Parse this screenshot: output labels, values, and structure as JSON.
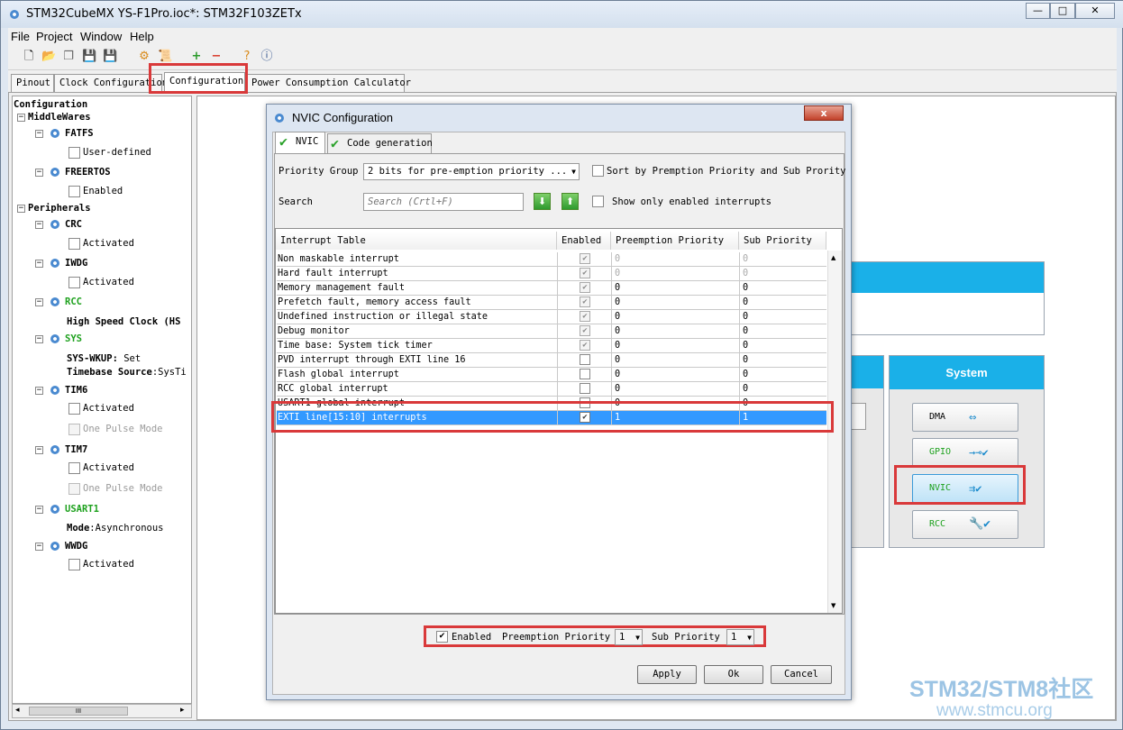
{
  "app": {
    "title": "STM32CubeMX YS-F1Pro.ioc*: STM32F103ZETx"
  },
  "window_controls": {
    "minimize": "—",
    "maximize": "□",
    "close": "✕"
  },
  "menu": [
    "File",
    "Project",
    "Window",
    "Help"
  ],
  "tabs": [
    "Pinout",
    "Clock Configuration",
    "Configuration",
    "Power Consumption Calculator"
  ],
  "tree": {
    "root": "Configuration",
    "middlewares": "MiddleWares",
    "fatfs": "FATFS",
    "user_defined": "User-defined",
    "freertos": "FREERTOS",
    "enabled": "Enabled",
    "peripherals": "Peripherals",
    "crc": "CRC",
    "activated": "Activated",
    "iwdg": "IWDG",
    "rcc": "RCC",
    "hse": "High Speed Clock (HS",
    "sys": "SYS",
    "sys_wkup_k": "SYS-WKUP:",
    "sys_wkup_v": " Set",
    "timebase_k": "Timebase Source",
    "timebase_v": ":SysTi",
    "tim6": "TIM6",
    "one_pulse": "One Pulse Mode",
    "tim7": "TIM7",
    "usart1": "USART1",
    "mode_k": "Mode",
    "mode_v": ":Asynchronous",
    "wwdg": "WWDG",
    "scroll_thumb": "III"
  },
  "system_panel": {
    "title": "System",
    "buttons": [
      "DMA",
      "GPIO",
      "NVIC",
      "RCC"
    ]
  },
  "dialog": {
    "title": "NVIC Configuration",
    "close": "x",
    "tabs": [
      "NVIC",
      "Code generation"
    ],
    "priority_group_label": "Priority Group",
    "priority_group_value": "2 bits for pre-emption priority ...",
    "sort_label": "Sort by Premption Priority and Sub Prority",
    "search_label": "Search",
    "search_placeholder": "Search (Crtl+F)",
    "show_enabled_label": "Show only enabled interrupts",
    "columns": [
      "Interrupt Table",
      "Enabled",
      "Preemption Priority",
      "Sub Priority"
    ],
    "rows": [
      {
        "name": "Non maskable interrupt",
        "enabled": true,
        "locked": true,
        "pre": "0",
        "sub": "0",
        "gray": true
      },
      {
        "name": "Hard fault interrupt",
        "enabled": true,
        "locked": true,
        "pre": "0",
        "sub": "0",
        "gray": true
      },
      {
        "name": "Memory management fault",
        "enabled": true,
        "locked": true,
        "pre": "0",
        "sub": "0",
        "gray": false
      },
      {
        "name": "Prefetch fault, memory access fault",
        "enabled": true,
        "locked": true,
        "pre": "0",
        "sub": "0",
        "gray": false
      },
      {
        "name": "Undefined instruction or illegal state",
        "enabled": true,
        "locked": true,
        "pre": "0",
        "sub": "0",
        "gray": false
      },
      {
        "name": "Debug monitor",
        "enabled": true,
        "locked": true,
        "pre": "0",
        "sub": "0",
        "gray": false
      },
      {
        "name": "Time base: System tick timer",
        "enabled": true,
        "locked": true,
        "pre": "0",
        "sub": "0",
        "gray": false
      },
      {
        "name": "PVD interrupt through EXTI line 16",
        "enabled": false,
        "locked": false,
        "pre": "0",
        "sub": "0",
        "gray": false
      },
      {
        "name": "Flash global interrupt",
        "enabled": false,
        "locked": false,
        "pre": "0",
        "sub": "0",
        "gray": false
      },
      {
        "name": "RCC global interrupt",
        "enabled": false,
        "locked": false,
        "pre": "0",
        "sub": "0",
        "gray": false
      },
      {
        "name": "USART1 global interrupt",
        "enabled": false,
        "locked": false,
        "pre": "0",
        "sub": "0",
        "gray": false
      },
      {
        "name": "EXTI line[15:10] interrupts",
        "enabled": true,
        "locked": false,
        "pre": "1",
        "sub": "1",
        "gray": false,
        "selected": true
      }
    ],
    "bottom": {
      "enabled_label": "Enabled",
      "preemption_label": "Preemption Priority",
      "preemption_value": "1",
      "sub_label": "Sub Priority",
      "sub_value": "1"
    },
    "buttons": {
      "apply": "Apply",
      "ok": "Ok",
      "cancel": "Cancel"
    }
  },
  "watermark": {
    "line1": "STM32/STM8社区",
    "line2": "www.stmcu.org"
  },
  "colors": {
    "selection": "#3399ff",
    "highlight_box": "#d9393a",
    "system_header": "#1ab0e8",
    "green_text": "#1ea11e"
  }
}
